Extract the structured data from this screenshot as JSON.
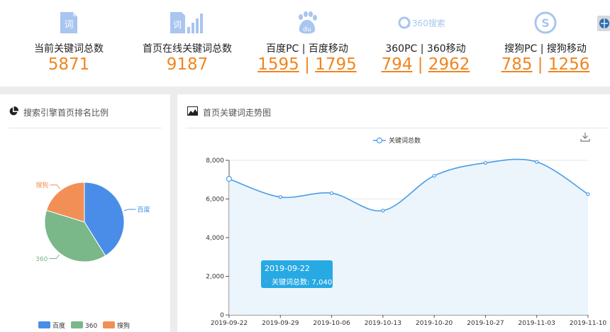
{
  "stats": [
    {
      "label": "当前关键词总数",
      "value": "5871"
    },
    {
      "label": "首页在线关键词总数",
      "value": "9187"
    },
    {
      "label": "百度PC | 百度移动",
      "value_a": "1595",
      "sep": " | ",
      "value_b": "1795"
    },
    {
      "label": "360PC | 360移动",
      "value_a": "794",
      "sep": " | ",
      "value_b": "2962"
    },
    {
      "label": "搜狗PC | 搜狗移动",
      "value_a": "785",
      "sep": " | ",
      "value_b": "1256"
    }
  ],
  "icons": {
    "ci_glyph": "词",
    "du_glyph": "du",
    "logo_360": "360搜索",
    "sogou_glyph": "S"
  },
  "pie_panel": {
    "title": "搜索引擎首页排名比例",
    "legend": [
      "百度",
      "360",
      "搜狗"
    ]
  },
  "trend_panel": {
    "title": "首页关键词走势图",
    "tooltip": {
      "date": "2019-09-22",
      "text": "关键词总数: 7,040"
    }
  },
  "colors": {
    "accent": "#f0851f",
    "baidu": "#4a8de8",
    "c360": "#7ab789",
    "sogou": "#f28f57",
    "line": "#4a9ee8",
    "tooltip": "#27a9e3"
  },
  "chart_data": [
    {
      "type": "pie",
      "labels": [
        "百度",
        "360",
        "搜狗"
      ],
      "values": [
        1595,
        1500,
        785
      ],
      "legend": [
        "百度",
        "360",
        "搜狗"
      ]
    },
    {
      "type": "area",
      "series": [
        {
          "name": "关键词总数",
          "values": [
            7040,
            6100,
            6300,
            5400,
            7200,
            7870,
            7920,
            6250
          ]
        }
      ],
      "x": [
        "2019-09-22",
        "2019-09-29",
        "2019-10-06",
        "2019-10-13",
        "2019-10-20",
        "2019-10-27",
        "2019-11-03",
        "2019-11-10"
      ],
      "yticks": [
        "0",
        "2,000",
        "4,000",
        "6,000",
        "8,000"
      ],
      "ylim": [
        0,
        8000
      ],
      "legend": [
        "关键词总数"
      ],
      "grid": true
    }
  ]
}
